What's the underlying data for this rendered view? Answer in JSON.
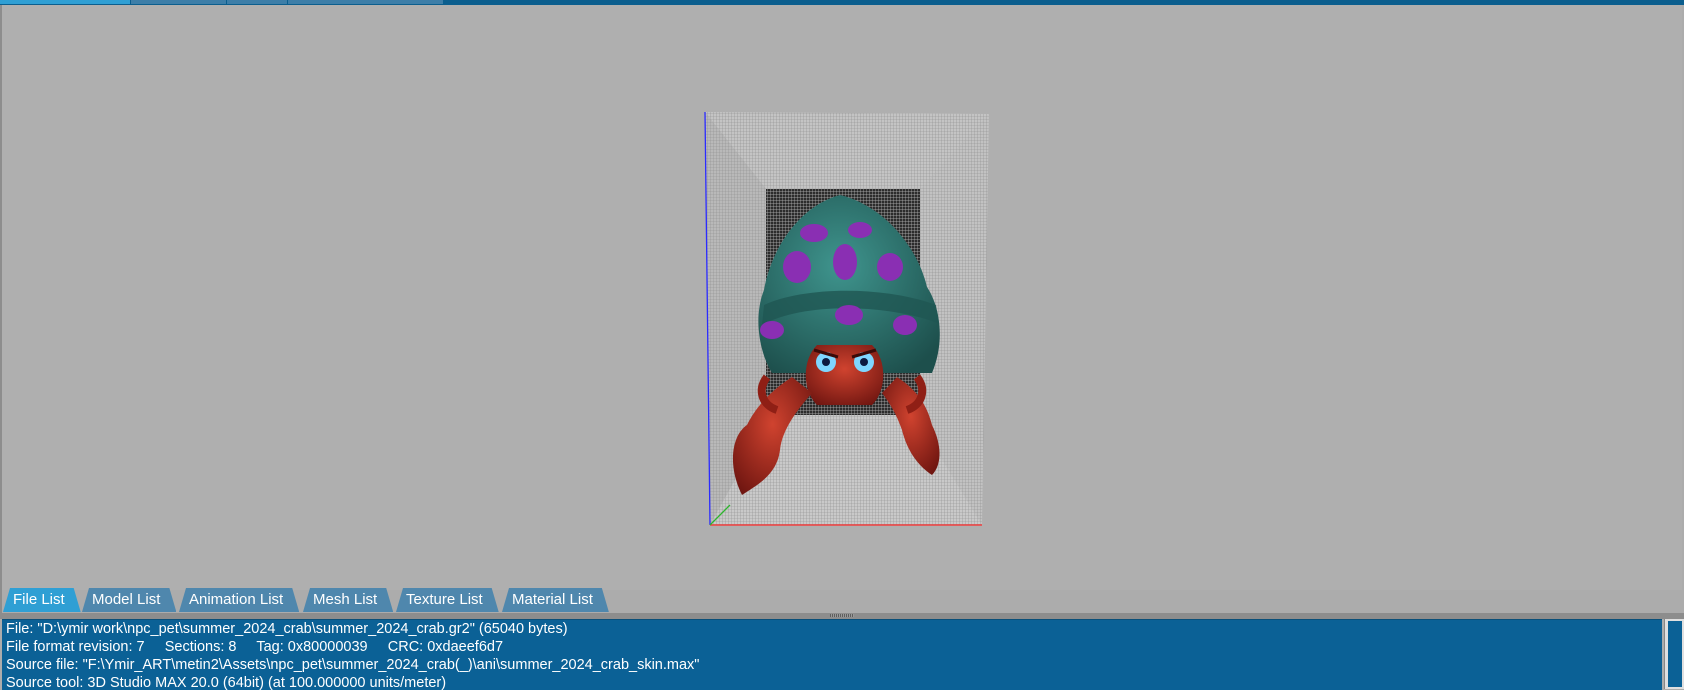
{
  "window": {
    "tabs": [
      {
        "label": "File List",
        "active": true
      },
      {
        "label": "Model List",
        "active": false
      },
      {
        "label": "Animation List",
        "active": false
      },
      {
        "label": "Mesh List",
        "active": false
      },
      {
        "label": "Texture List",
        "active": false
      },
      {
        "label": "Material List",
        "active": false
      }
    ]
  },
  "info": {
    "lines": [
      "File: \"D:\\ymir work\\npc_pet\\summer_2024_crab\\summer_2024_crab.gr2\" (65040 bytes)",
      "File format revision: 7     Sections: 8     Tag: 0x80000039     CRC: 0xdaeef6d7",
      "Source file: \"F:\\Ymir_ART\\metin2\\Assets\\npc_pet\\summer_2024_crab(_)\\ani\\summer_2024_crab_skin.max\"",
      "Source tool: 3D Studio MAX 20.0 (64bit) (at 100.000000 units/meter)"
    ]
  },
  "colors": {
    "viewport_bg": "#afafaf",
    "tab_active": "#2f9fd4",
    "tab_inactive": "#4f87ad",
    "info_bg": "#0b6196",
    "axis_x": "#ff2a2a",
    "axis_y": "#2db52d",
    "axis_z": "#2b2bff",
    "shell": "#2f7c76",
    "shell_stripe": "#8a2fb3",
    "crab_body": "#b0291e"
  },
  "icons": {
    "splitter": "grip-icon"
  }
}
